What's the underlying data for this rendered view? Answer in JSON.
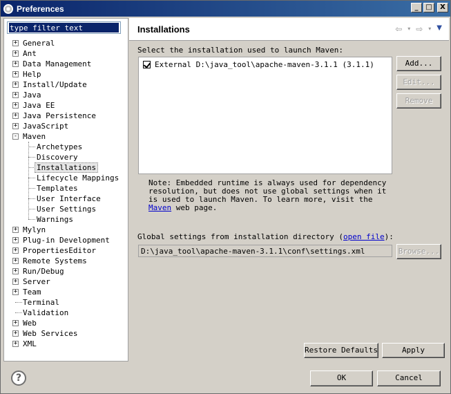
{
  "window": {
    "title": "Preferences",
    "min_label": "_",
    "max_label": "□",
    "close_label": "X"
  },
  "filter": {
    "value": "type filter text"
  },
  "tree": {
    "expand_glyph": "+",
    "collapse_glyph": "-",
    "items": [
      {
        "label": "General"
      },
      {
        "label": "Ant"
      },
      {
        "label": "Data Management"
      },
      {
        "label": "Help"
      },
      {
        "label": "Install/Update"
      },
      {
        "label": "Java"
      },
      {
        "label": "Java EE"
      },
      {
        "label": "Java Persistence"
      },
      {
        "label": "JavaScript"
      },
      {
        "label": "Maven"
      },
      {
        "label": "Archetypes"
      },
      {
        "label": "Discovery"
      },
      {
        "label": "Installations"
      },
      {
        "label": "Lifecycle Mappings"
      },
      {
        "label": "Templates"
      },
      {
        "label": "User Interface"
      },
      {
        "label": "User Settings"
      },
      {
        "label": "Warnings"
      },
      {
        "label": "Mylyn"
      },
      {
        "label": "Plug-in Development"
      },
      {
        "label": "PropertiesEditor"
      },
      {
        "label": "Remote Systems"
      },
      {
        "label": "Run/Debug"
      },
      {
        "label": "Server"
      },
      {
        "label": "Team"
      },
      {
        "label": "Terminal"
      },
      {
        "label": "Validation"
      },
      {
        "label": "Web"
      },
      {
        "label": "Web Services"
      },
      {
        "label": "XML"
      }
    ]
  },
  "page": {
    "title": "Installations",
    "nav": {
      "back": "⇦",
      "forward": "⇨",
      "dropdown": "▾",
      "menu": "▼"
    },
    "select_label": "Select the installation used to launch Maven:",
    "installation": "External D:\\java_tool\\apache-maven-3.1.1 (3.1.1)",
    "buttons": {
      "add": "Add...",
      "edit": "Edit...",
      "remove": "Remove"
    },
    "note_before": "Note: Embedded runtime is always used for dependency resolution, but does not use global settings when it is used to launch Maven. To learn more, visit the ",
    "note_link": "Maven",
    "note_after": " web page.",
    "global_before": "Global settings from installation directory (",
    "global_link": "open file",
    "global_after": "):",
    "global_path": "D:\\java_tool\\apache-maven-3.1.1\\conf\\settings.xml",
    "browse": "Browse...",
    "restore_defaults": "Restore Defaults",
    "apply": "Apply"
  },
  "footer": {
    "help": "?",
    "ok": "OK",
    "cancel": "Cancel"
  }
}
